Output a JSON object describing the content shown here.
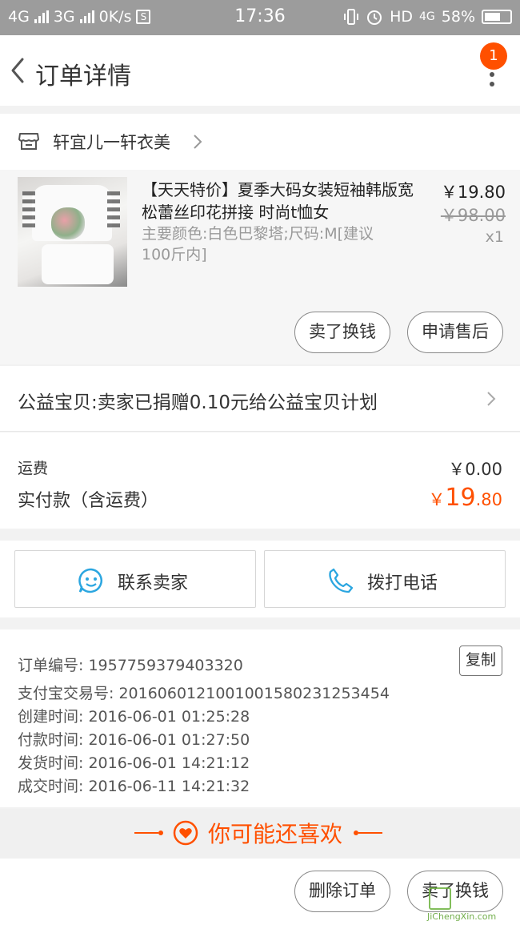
{
  "status_bar": {
    "net1": "4G",
    "net2": "3G",
    "speed": "0K/s",
    "sim_glyph": "S",
    "time": "17:36",
    "hd": "HD",
    "net3": "4G",
    "battery": "58%"
  },
  "nav": {
    "title": "订单详情",
    "badge_count": "1"
  },
  "shop": {
    "name": "轩宜儿一轩衣美"
  },
  "item": {
    "title": "【天天特价】夏季大码女装短袖韩版宽松蕾丝印花拼接 时尚t恤女",
    "sku": "主要颜色:白色巴黎塔;尺码:M[建议100斤内]",
    "price": "￥19.80",
    "original_price": "￥98.00",
    "quantity": "x1",
    "resell_label": "卖了换钱",
    "after_sale_label": "申请售后"
  },
  "charity": {
    "text": "公益宝贝:卖家已捐赠0.10元给公益宝贝计划"
  },
  "payment": {
    "shipping_label": "运费",
    "shipping_value": "￥0.00",
    "paid_label": "实付款（含运费）",
    "paid_currency": "￥",
    "paid_integer": "19",
    "paid_decimal": ".80"
  },
  "contact": {
    "seller_label": "联系卖家",
    "phone_label": "拨打电话"
  },
  "order_info": {
    "order_no": "订单编号: 1957759379403320",
    "copy_label": "复制",
    "alipay_no": "支付宝交易号: 2016060121001001580231253454",
    "created": "创建时间: 2016-06-01 01:25:28",
    "paid": "付款时间: 2016-06-01 01:27:50",
    "shipped": "发货时间: 2016-06-01 14:21:12",
    "completed": "成交时间: 2016-06-11 14:21:32"
  },
  "recommend": {
    "title": "你可能还喜欢"
  },
  "bottom": {
    "delete_label": "删除订单",
    "resell_label": "卖了换钱"
  },
  "watermark": {
    "text": "JiChengXin.com"
  },
  "colors": {
    "accent": "#ff5000",
    "contact_icon": "#2ba6e0",
    "status_bar": "#9c9c9c"
  }
}
